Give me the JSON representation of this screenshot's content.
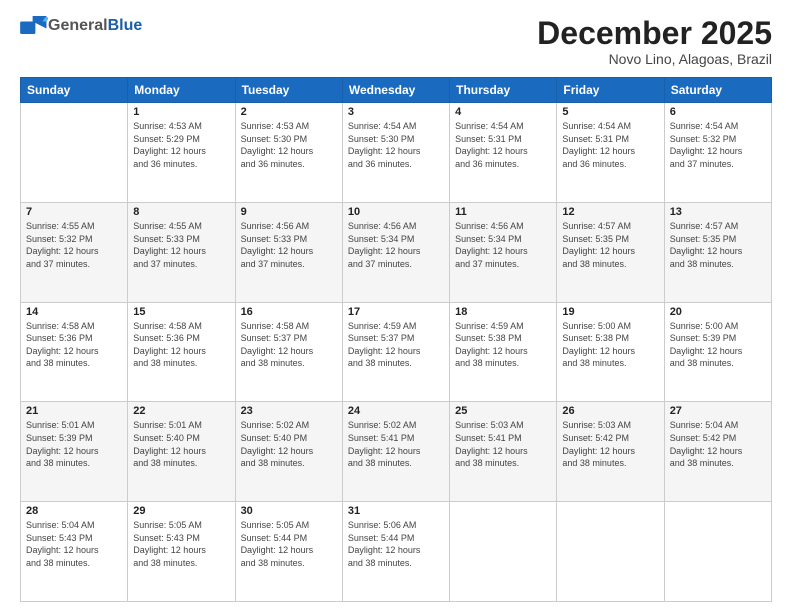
{
  "header": {
    "logo_general": "General",
    "logo_blue": "Blue",
    "month_title": "December 2025",
    "location": "Novo Lino, Alagoas, Brazil"
  },
  "days_of_week": [
    "Sunday",
    "Monday",
    "Tuesday",
    "Wednesday",
    "Thursday",
    "Friday",
    "Saturday"
  ],
  "weeks": [
    [
      {
        "day": "",
        "info": ""
      },
      {
        "day": "1",
        "info": "Sunrise: 4:53 AM\nSunset: 5:29 PM\nDaylight: 12 hours\nand 36 minutes."
      },
      {
        "day": "2",
        "info": "Sunrise: 4:53 AM\nSunset: 5:30 PM\nDaylight: 12 hours\nand 36 minutes."
      },
      {
        "day": "3",
        "info": "Sunrise: 4:54 AM\nSunset: 5:30 PM\nDaylight: 12 hours\nand 36 minutes."
      },
      {
        "day": "4",
        "info": "Sunrise: 4:54 AM\nSunset: 5:31 PM\nDaylight: 12 hours\nand 36 minutes."
      },
      {
        "day": "5",
        "info": "Sunrise: 4:54 AM\nSunset: 5:31 PM\nDaylight: 12 hours\nand 36 minutes."
      },
      {
        "day": "6",
        "info": "Sunrise: 4:54 AM\nSunset: 5:32 PM\nDaylight: 12 hours\nand 37 minutes."
      }
    ],
    [
      {
        "day": "7",
        "info": "Sunrise: 4:55 AM\nSunset: 5:32 PM\nDaylight: 12 hours\nand 37 minutes."
      },
      {
        "day": "8",
        "info": "Sunrise: 4:55 AM\nSunset: 5:33 PM\nDaylight: 12 hours\nand 37 minutes."
      },
      {
        "day": "9",
        "info": "Sunrise: 4:56 AM\nSunset: 5:33 PM\nDaylight: 12 hours\nand 37 minutes."
      },
      {
        "day": "10",
        "info": "Sunrise: 4:56 AM\nSunset: 5:34 PM\nDaylight: 12 hours\nand 37 minutes."
      },
      {
        "day": "11",
        "info": "Sunrise: 4:56 AM\nSunset: 5:34 PM\nDaylight: 12 hours\nand 37 minutes."
      },
      {
        "day": "12",
        "info": "Sunrise: 4:57 AM\nSunset: 5:35 PM\nDaylight: 12 hours\nand 38 minutes."
      },
      {
        "day": "13",
        "info": "Sunrise: 4:57 AM\nSunset: 5:35 PM\nDaylight: 12 hours\nand 38 minutes."
      }
    ],
    [
      {
        "day": "14",
        "info": "Sunrise: 4:58 AM\nSunset: 5:36 PM\nDaylight: 12 hours\nand 38 minutes."
      },
      {
        "day": "15",
        "info": "Sunrise: 4:58 AM\nSunset: 5:36 PM\nDaylight: 12 hours\nand 38 minutes."
      },
      {
        "day": "16",
        "info": "Sunrise: 4:58 AM\nSunset: 5:37 PM\nDaylight: 12 hours\nand 38 minutes."
      },
      {
        "day": "17",
        "info": "Sunrise: 4:59 AM\nSunset: 5:37 PM\nDaylight: 12 hours\nand 38 minutes."
      },
      {
        "day": "18",
        "info": "Sunrise: 4:59 AM\nSunset: 5:38 PM\nDaylight: 12 hours\nand 38 minutes."
      },
      {
        "day": "19",
        "info": "Sunrise: 5:00 AM\nSunset: 5:38 PM\nDaylight: 12 hours\nand 38 minutes."
      },
      {
        "day": "20",
        "info": "Sunrise: 5:00 AM\nSunset: 5:39 PM\nDaylight: 12 hours\nand 38 minutes."
      }
    ],
    [
      {
        "day": "21",
        "info": "Sunrise: 5:01 AM\nSunset: 5:39 PM\nDaylight: 12 hours\nand 38 minutes."
      },
      {
        "day": "22",
        "info": "Sunrise: 5:01 AM\nSunset: 5:40 PM\nDaylight: 12 hours\nand 38 minutes."
      },
      {
        "day": "23",
        "info": "Sunrise: 5:02 AM\nSunset: 5:40 PM\nDaylight: 12 hours\nand 38 minutes."
      },
      {
        "day": "24",
        "info": "Sunrise: 5:02 AM\nSunset: 5:41 PM\nDaylight: 12 hours\nand 38 minutes."
      },
      {
        "day": "25",
        "info": "Sunrise: 5:03 AM\nSunset: 5:41 PM\nDaylight: 12 hours\nand 38 minutes."
      },
      {
        "day": "26",
        "info": "Sunrise: 5:03 AM\nSunset: 5:42 PM\nDaylight: 12 hours\nand 38 minutes."
      },
      {
        "day": "27",
        "info": "Sunrise: 5:04 AM\nSunset: 5:42 PM\nDaylight: 12 hours\nand 38 minutes."
      }
    ],
    [
      {
        "day": "28",
        "info": "Sunrise: 5:04 AM\nSunset: 5:43 PM\nDaylight: 12 hours\nand 38 minutes."
      },
      {
        "day": "29",
        "info": "Sunrise: 5:05 AM\nSunset: 5:43 PM\nDaylight: 12 hours\nand 38 minutes."
      },
      {
        "day": "30",
        "info": "Sunrise: 5:05 AM\nSunset: 5:44 PM\nDaylight: 12 hours\nand 38 minutes."
      },
      {
        "day": "31",
        "info": "Sunrise: 5:06 AM\nSunset: 5:44 PM\nDaylight: 12 hours\nand 38 minutes."
      },
      {
        "day": "",
        "info": ""
      },
      {
        "day": "",
        "info": ""
      },
      {
        "day": "",
        "info": ""
      }
    ]
  ]
}
